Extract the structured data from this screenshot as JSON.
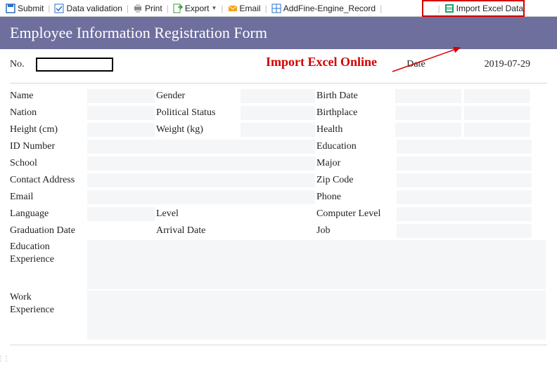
{
  "toolbar": {
    "submit": "Submit",
    "data_validation": "Data validation",
    "print": "Print",
    "export": "Export",
    "email": "Email",
    "add_record": "AddFine-Engine_Record",
    "import": "Import Excel Data"
  },
  "form": {
    "title": "Employee Information Registration Form",
    "no_label": "No.",
    "date_label": "Date",
    "date_value": "2019-07-29",
    "annotation": "Import Excel Online",
    "fields": {
      "name": "Name",
      "gender": "Gender",
      "birth_date": "Birth Date",
      "nation": "Nation",
      "political_status": "Political Status",
      "birthplace": "Birthplace",
      "height": "Height (cm)",
      "weight": "Weight (kg)",
      "health": "Health",
      "id_number": "ID Number",
      "education": "Education",
      "school": "School",
      "major": "Major",
      "contact_address": "Contact Address",
      "zip_code": "Zip Code",
      "email": "Email",
      "phone": "Phone",
      "language": "Language",
      "level": "Level",
      "computer_level": "Computer Level",
      "graduation_date": "Graduation Date",
      "arrival_date": "Arrival Date",
      "job": "Job",
      "education_experience": "Education Experience",
      "work_experience_1": "Work",
      "work_experience_2": "Experience"
    }
  }
}
